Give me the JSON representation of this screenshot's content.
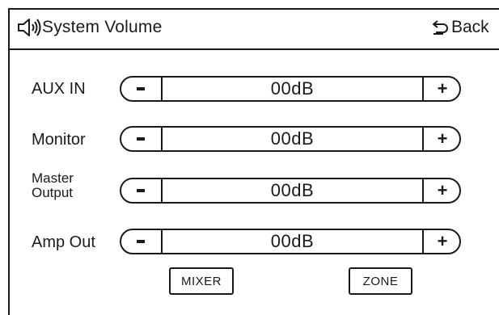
{
  "header": {
    "title": "System Volume",
    "back_label": "Back",
    "icons": {
      "title_icon": "speaker-volume-icon",
      "back_icon": "return-arrow-icon"
    }
  },
  "channels": [
    {
      "label": "AUX IN",
      "value": "00dB",
      "minus_symbol": "-",
      "plus_symbol": "+"
    },
    {
      "label": "Monitor",
      "value": "00dB",
      "minus_symbol": "-",
      "plus_symbol": "+"
    },
    {
      "label_line1": "Master",
      "label_line2": "Output",
      "value": "00dB",
      "minus_symbol": "-",
      "plus_symbol": "+"
    },
    {
      "label": "Amp Out",
      "value": "00dB",
      "minus_symbol": "-",
      "plus_symbol": "+"
    }
  ],
  "footer": {
    "mixer_label": "MIXER",
    "zone_label": "ZONE"
  },
  "colors": {
    "ink": "#1a1a1a",
    "background": "#ffffff"
  }
}
